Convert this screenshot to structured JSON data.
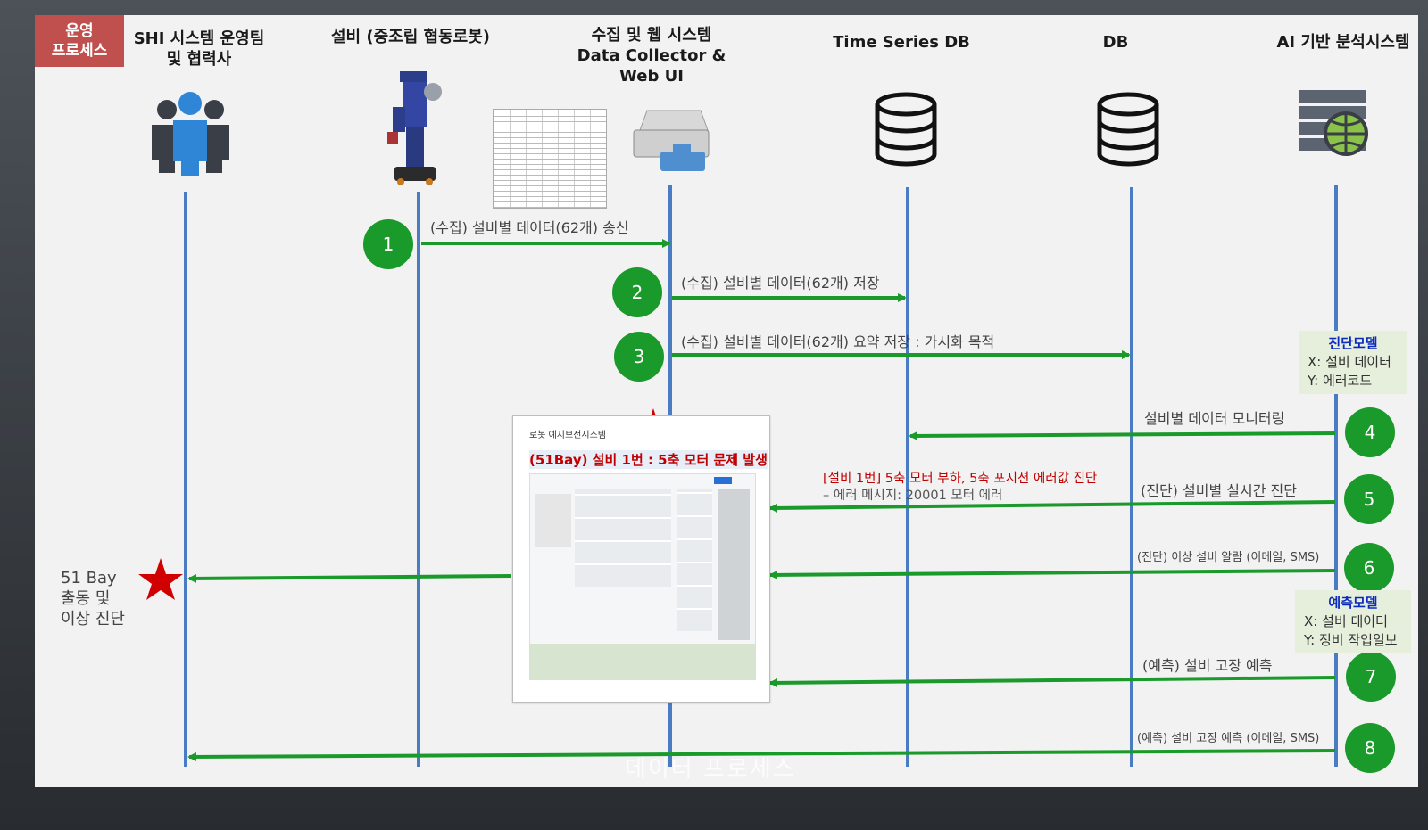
{
  "process_badge": [
    "운영",
    "프로세스"
  ],
  "headers": {
    "team": [
      "SHI 시스템 운영팀",
      "및 협력사"
    ],
    "equipment": "설비 (중조립 협동로봇)",
    "collector": [
      "수집 및 웹 시스템",
      "Data Collector &",
      "Web UI"
    ],
    "tsdb": "Time Series DB",
    "db": "DB",
    "ai": "AI 기반 분석시스템"
  },
  "steps": [
    {
      "num": "1",
      "label": "(수집) 설비별 데이터(62개) 송신"
    },
    {
      "num": "2",
      "label": "(수집) 설비별 데이터(62개) 저장"
    },
    {
      "num": "3",
      "label": "(수집) 설비별 데이터(62개) 요약 저장 : 가시화 목적"
    },
    {
      "num": "4",
      "label": "설비별 데이터 모니터링"
    },
    {
      "num": "5",
      "label": "(진단) 설비별 실시간 진단"
    },
    {
      "num": "6",
      "label": "(진단) 이상 설비 알람 (이메일, SMS)"
    },
    {
      "num": "7",
      "label": "(예측) 설비 고장 예측"
    },
    {
      "num": "8",
      "label": "(예측) 설비 고장 예측 (이메일, SMS)"
    }
  ],
  "diagnosis_model": {
    "title": "진단모델",
    "x": "X: 설비 데이터",
    "y": "Y: 에러코드"
  },
  "prediction_model": {
    "title": "예측모델",
    "x": "X: 설비 데이터",
    "y": "Y: 정비 작업일보"
  },
  "diagnosis_text": "[설비 1번] 5축 모터 부하, 5축 포지션 에러값 진단",
  "error_text": "– 에러 메시지: 20001 모터 에러",
  "screen": {
    "title": "로봇 예지보전시스템",
    "alert": "(51Bay) 설비 1번 : 5축 모터 문제 발생"
  },
  "side_note": [
    "51 Bay",
    "출동 및",
    "이상 진단"
  ],
  "footer": "데이터 프로세스",
  "colors": {
    "arrow": "#1a9a2a",
    "lifeline": "#4a7cc4",
    "badge": "#c0504d",
    "star": "#d10000"
  }
}
